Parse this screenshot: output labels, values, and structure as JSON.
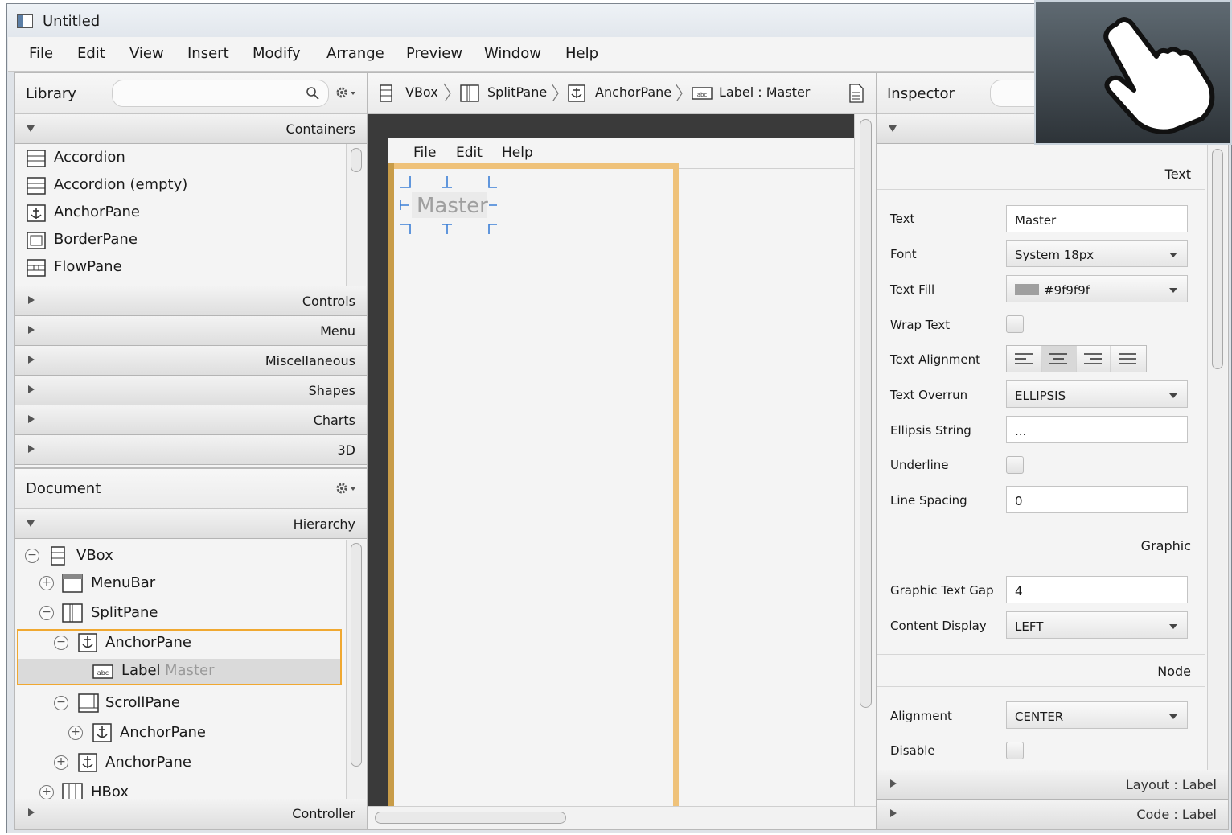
{
  "window": {
    "title": "Untitled"
  },
  "menu": [
    "File",
    "Edit",
    "View",
    "Insert",
    "Modify",
    "Arrange",
    "Preview",
    "Window",
    "Help"
  ],
  "library": {
    "title": "Library",
    "search_placeholder": "",
    "containers_label": "Containers",
    "items": [
      "Accordion",
      "Accordion  (empty)",
      "AnchorPane",
      "BorderPane",
      "FlowPane"
    ],
    "sections": [
      "Controls",
      "Menu",
      "Miscellaneous",
      "Shapes",
      "Charts",
      "3D"
    ]
  },
  "document": {
    "title": "Document",
    "hierarchy_label": "Hierarchy",
    "tree": [
      {
        "label": "VBox",
        "note": ""
      },
      {
        "label": "MenuBar",
        "note": ""
      },
      {
        "label": "SplitPane",
        "note": ""
      },
      {
        "label": "AnchorPane",
        "note": ""
      },
      {
        "label": "Label",
        "note": "Master"
      },
      {
        "label": "ScrollPane",
        "note": ""
      },
      {
        "label": "AnchorPane",
        "note": ""
      },
      {
        "label": "AnchorPane",
        "note": ""
      },
      {
        "label": "HBox",
        "note": ""
      }
    ],
    "controller_label": "Controller"
  },
  "breadcrumb": [
    "VBox",
    "SplitPane",
    "AnchorPane",
    "Label : Master"
  ],
  "canvas": {
    "menu": [
      "File",
      "Edit",
      "Help"
    ],
    "label_text": "Master"
  },
  "inspector": {
    "title": "Inspector",
    "text_section": "Text",
    "props": {
      "text_label": "Text",
      "text_value": "Master",
      "font_label": "Font",
      "font_value": "System 18px",
      "fill_label": "Text Fill",
      "fill_value": "#9f9f9f",
      "wrap_label": "Wrap Text",
      "align_label": "Text Alignment",
      "overrun_label": "Text Overrun",
      "overrun_value": "ELLIPSIS",
      "ellipsis_label": "Ellipsis String",
      "ellipsis_value": "...",
      "underline_label": "Underline",
      "spacing_label": "Line Spacing",
      "spacing_value": "0"
    },
    "graphic_section": "Graphic",
    "graphic": {
      "gap_label": "Graphic Text Gap",
      "gap_value": "4",
      "display_label": "Content Display",
      "display_value": "LEFT"
    },
    "node_section": "Node",
    "node": {
      "alignment_label": "Alignment",
      "alignment_value": "CENTER",
      "disable_label": "Disable"
    },
    "layout_label": "Layout : Label",
    "code_label": "Code : Label"
  },
  "colors": {
    "selection": "#f0a830",
    "fill_swatch": "#9f9f9f"
  }
}
